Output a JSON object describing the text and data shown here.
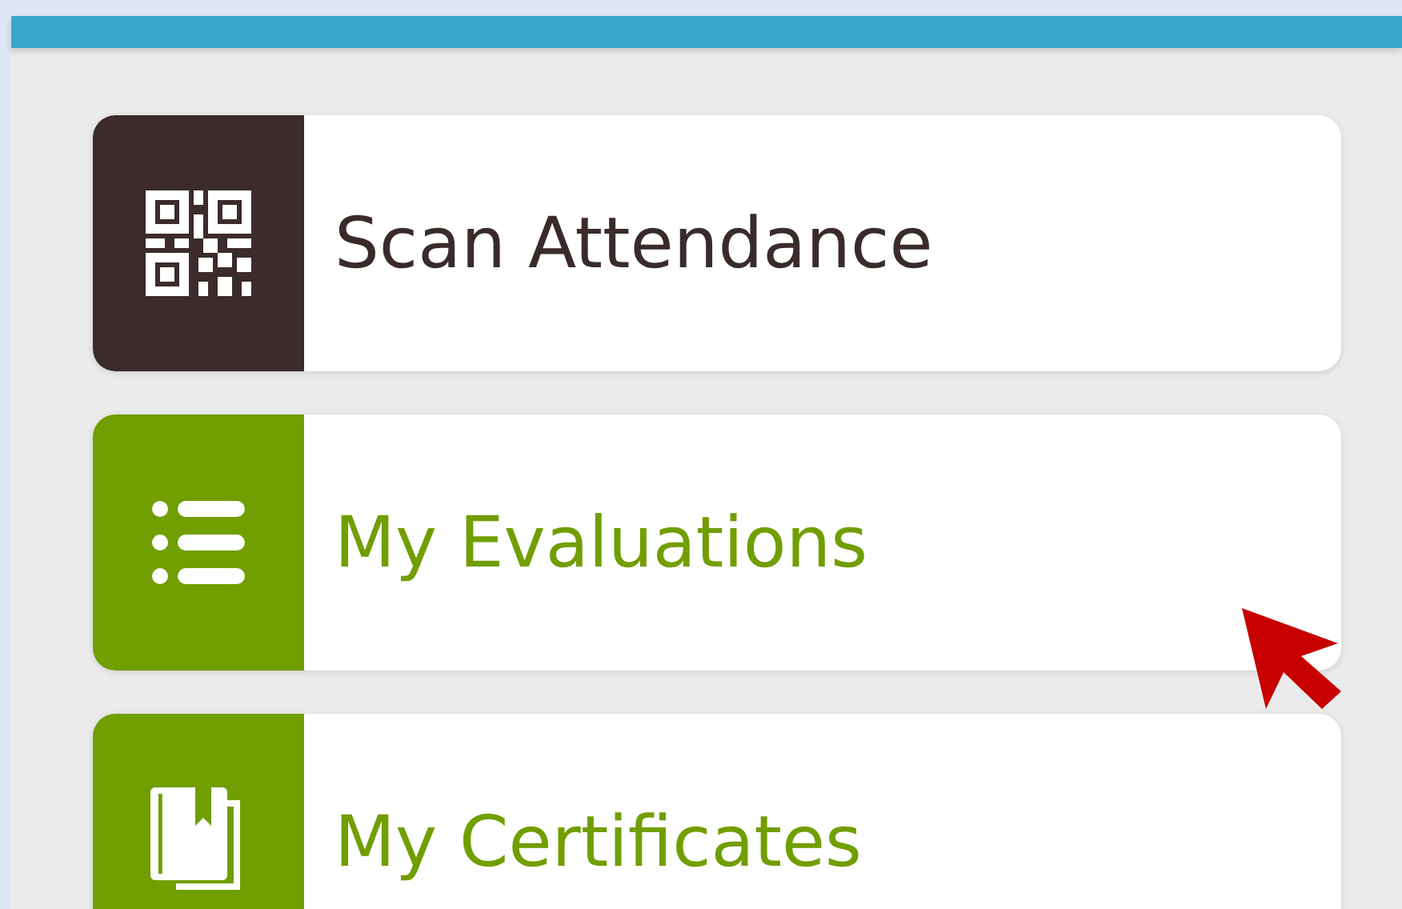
{
  "menu": [
    {
      "label": "Scan Attendance",
      "color": "#3c2b2b",
      "kind": "qr"
    },
    {
      "label": "My Evaluations",
      "color": "#719e00",
      "kind": "list"
    },
    {
      "label": "My Certificates",
      "color": "#719e00",
      "kind": "book"
    }
  ]
}
